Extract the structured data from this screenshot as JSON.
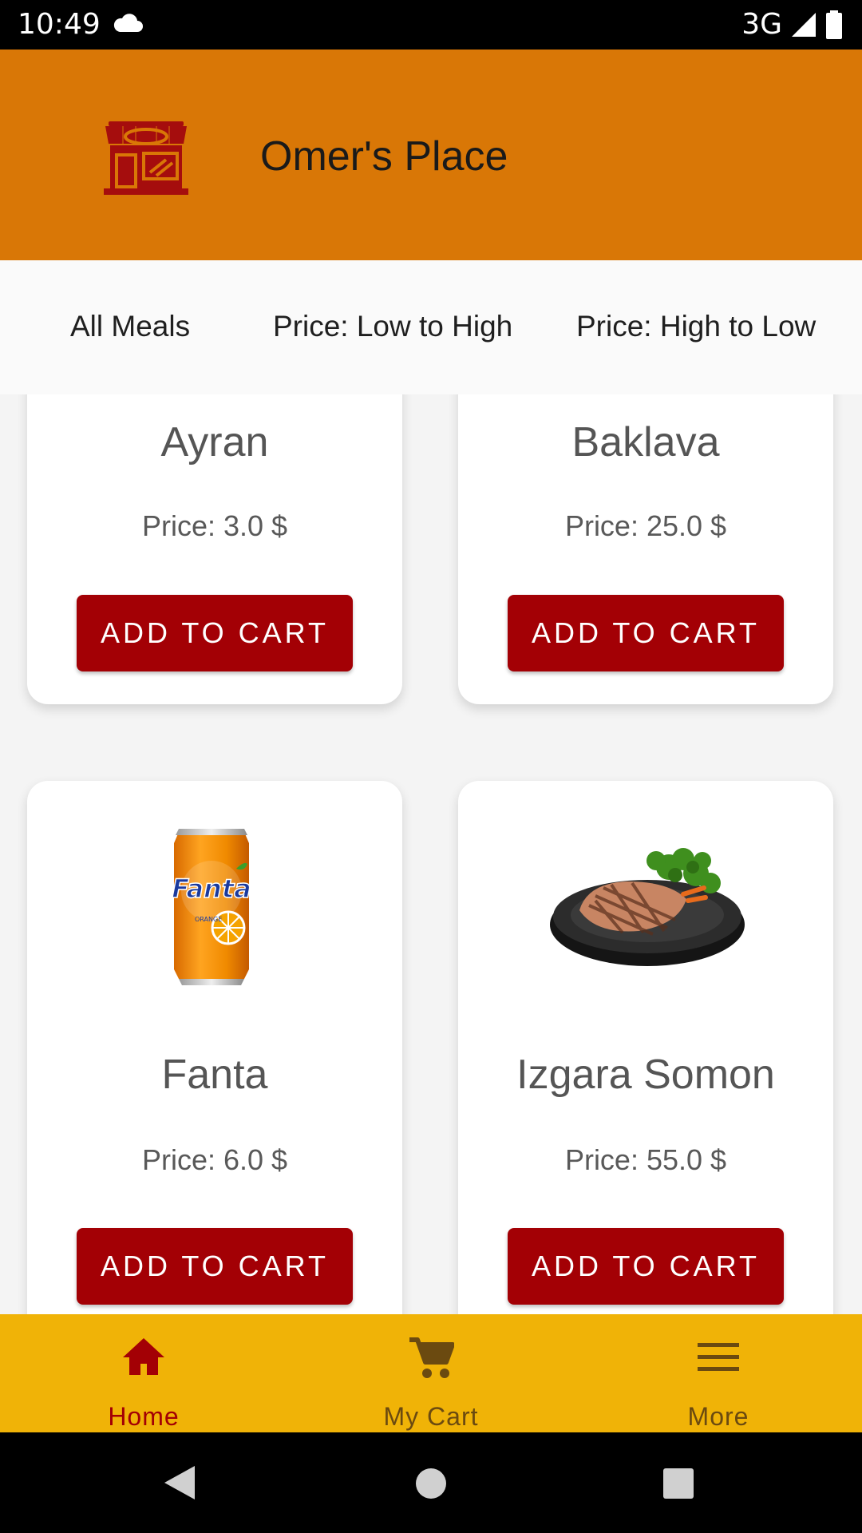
{
  "status_bar": {
    "time": "10:49",
    "network": "3G"
  },
  "header": {
    "title": "Omer's Place"
  },
  "filters": [
    "All Meals",
    "Price: Low to High",
    "Price: High to Low"
  ],
  "products": [
    {
      "name": "Ayran",
      "price": "Price: 3.0 $",
      "button": "ADD TO CART"
    },
    {
      "name": "Baklava",
      "price": "Price: 25.0 $",
      "button": "ADD TO CART"
    },
    {
      "name": "Fanta",
      "price": "Price: 6.0 $",
      "button": "ADD TO CART",
      "can_text": "Fanta",
      "can_sub": "ORANGE"
    },
    {
      "name": "Izgara Somon",
      "price": "Price: 55.0 $",
      "button": "ADD TO CART"
    }
  ],
  "bottom_nav": [
    {
      "label": "Home",
      "icon": "home-icon",
      "active": true
    },
    {
      "label": "My Cart",
      "icon": "cart-icon",
      "active": false
    },
    {
      "label": "More",
      "icon": "menu-icon",
      "active": false
    }
  ],
  "colors": {
    "header": "#d97706",
    "accent": "#a30005",
    "nav_bg": "#f0b307",
    "nav_inactive": "#6b4a10"
  }
}
